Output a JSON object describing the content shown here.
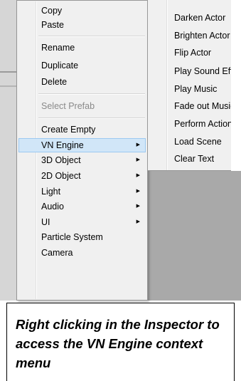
{
  "context_menu": {
    "items": [
      {
        "label": "Copy",
        "disabled": false,
        "has_submenu": false
      },
      {
        "label": "Paste",
        "disabled": false,
        "has_submenu": false
      },
      {
        "label": "Rename",
        "disabled": false,
        "has_submenu": false
      },
      {
        "label": "Duplicate",
        "disabled": false,
        "has_submenu": false
      },
      {
        "label": "Delete",
        "disabled": false,
        "has_submenu": false
      },
      {
        "label": "Select Prefab",
        "disabled": true,
        "has_submenu": false
      },
      {
        "label": "Create Empty",
        "disabled": false,
        "has_submenu": false
      },
      {
        "label": "VN Engine",
        "disabled": false,
        "has_submenu": true,
        "highlighted": true
      },
      {
        "label": "3D Object",
        "disabled": false,
        "has_submenu": true
      },
      {
        "label": "2D Object",
        "disabled": false,
        "has_submenu": true
      },
      {
        "label": "Light",
        "disabled": false,
        "has_submenu": true
      },
      {
        "label": "Audio",
        "disabled": false,
        "has_submenu": true
      },
      {
        "label": "UI",
        "disabled": false,
        "has_submenu": true
      },
      {
        "label": "Particle System",
        "disabled": false,
        "has_submenu": false
      },
      {
        "label": "Camera",
        "disabled": false,
        "has_submenu": false
      }
    ],
    "submenu_arrow": "▶"
  },
  "vn_engine_submenu": {
    "items": [
      {
        "label": "Darken Actor"
      },
      {
        "label": "Brighten Actor"
      },
      {
        "label": "Flip Actor"
      },
      {
        "label": "Play Sound Effect"
      },
      {
        "label": "Play Music"
      },
      {
        "label": "Fade out Music"
      },
      {
        "label": "Perform Action"
      },
      {
        "label": "Load Scene"
      },
      {
        "label": "Clear Text"
      }
    ]
  },
  "caption": {
    "text": "Right clicking in the Inspector to access the VN Engine context menu"
  },
  "colors": {
    "menu_bg": "#f0f0f0",
    "highlight_bg": "#d1e6f8",
    "highlight_border": "#9cc9f1",
    "disabled_text": "#8a8a8a"
  }
}
